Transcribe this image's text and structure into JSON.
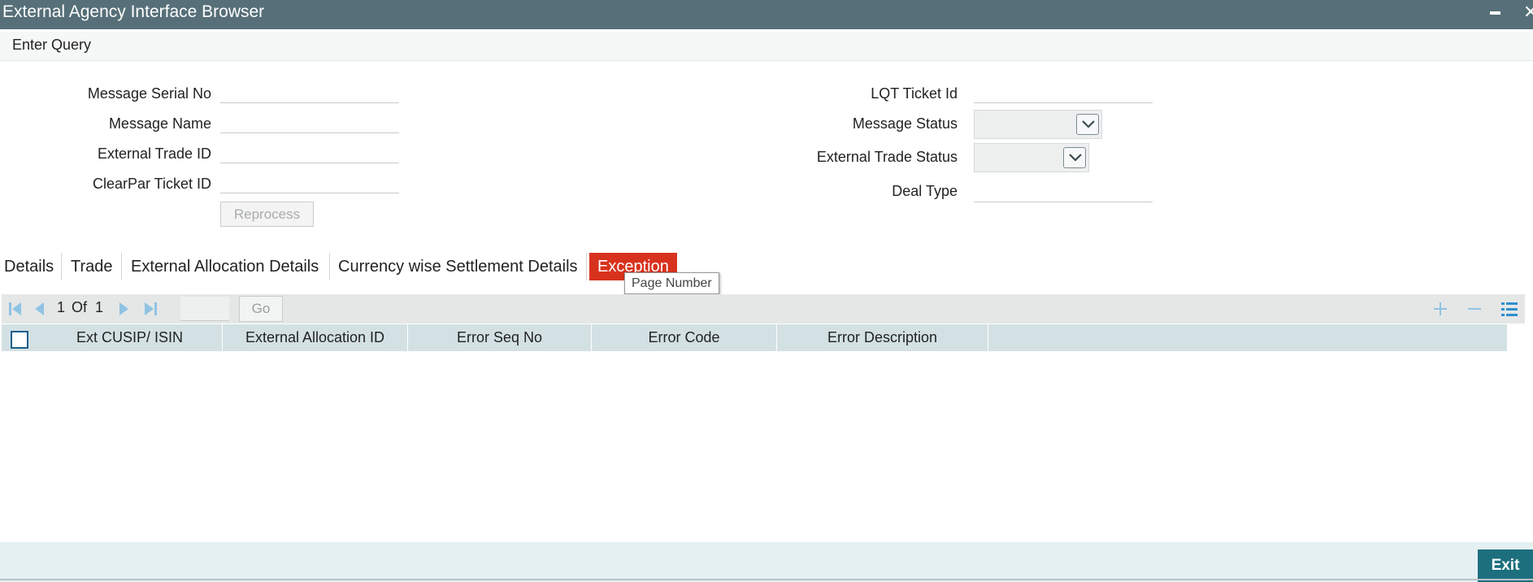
{
  "window": {
    "title": "External Agency Interface Browser"
  },
  "menubar": {
    "enter_query": "Enter Query"
  },
  "form": {
    "left": [
      {
        "label": "Message Serial No",
        "value": ""
      },
      {
        "label": "Message Name",
        "value": ""
      },
      {
        "label": "External Trade ID",
        "value": ""
      },
      {
        "label": "ClearPar Ticket ID",
        "value": ""
      }
    ],
    "reprocess_label": "Reprocess",
    "right": {
      "lqt_ticket_id": {
        "label": "LQT Ticket Id",
        "value": ""
      },
      "message_status": {
        "label": "Message Status",
        "selected": ""
      },
      "external_trade_status": {
        "label": "External Trade Status",
        "selected": ""
      },
      "deal_type": {
        "label": "Deal Type",
        "value": ""
      }
    }
  },
  "tabs": [
    {
      "label": "Details"
    },
    {
      "label": "Trade"
    },
    {
      "label": "External Allocation Details"
    },
    {
      "label": "Currency wise Settlement Details"
    },
    {
      "label": "Exception",
      "active": true
    }
  ],
  "tooltip": "Page Number",
  "pager": {
    "current": "1",
    "of_label": "Of",
    "total": "1",
    "go_label": "Go"
  },
  "grid": {
    "columns": [
      "Ext CUSIP/ ISIN",
      "External Allocation ID",
      "Error Seq No",
      "Error Code",
      "Error Description"
    ],
    "rows": []
  },
  "footer": {
    "exit_label": "Exit"
  },
  "colors": {
    "titlebar": "#566f78",
    "active_tab": "#d8321e",
    "grid_header": "#d3e1e4",
    "exit_button": "#1d6f7e",
    "pager_icon": "#8fc3e3"
  },
  "icons": [
    "minimize-icon",
    "close-icon",
    "chevron-down-icon",
    "first-page-icon",
    "prev-page-icon",
    "next-page-icon",
    "last-page-icon",
    "add-row-icon",
    "delete-row-icon",
    "single-record-view-icon"
  ]
}
